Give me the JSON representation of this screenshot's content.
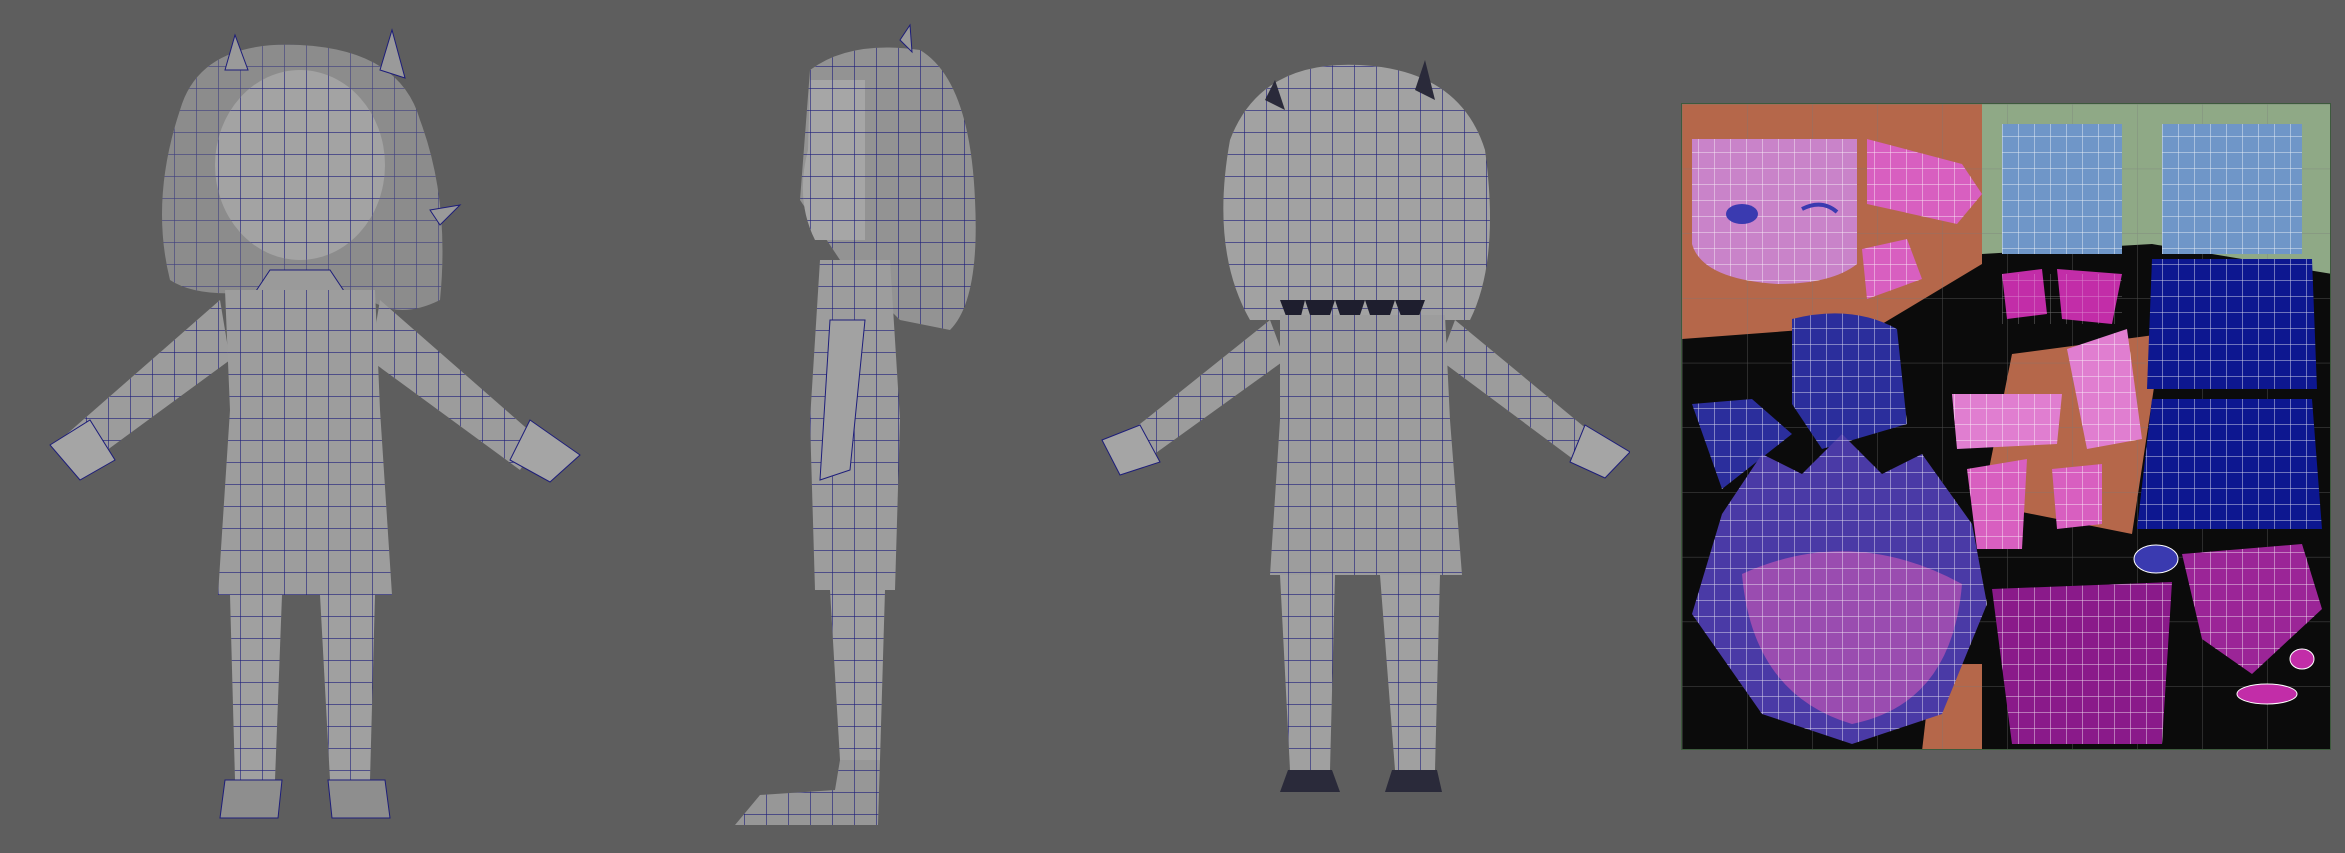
{
  "scene": {
    "views": [
      {
        "name": "front"
      },
      {
        "name": "side"
      },
      {
        "name": "back"
      }
    ],
    "uv_map": {
      "name": "uv-texture-layout"
    }
  },
  "colors": {
    "background": "#5e5e5e",
    "mesh_fill": "#9a9a9a",
    "mesh_dark": "#6f6f6f",
    "wire": "#1d1d7a",
    "uv_orange": "#b5674a",
    "uv_green": "#8fa986",
    "uv_pink": "#d85fc0",
    "uv_blue": "#2b2e9c",
    "uv_navy": "#0d1790",
    "uv_lightblue": "#6f96c8",
    "uv_purple": "#8a1a8a",
    "uv_grid": "#ffffff"
  }
}
